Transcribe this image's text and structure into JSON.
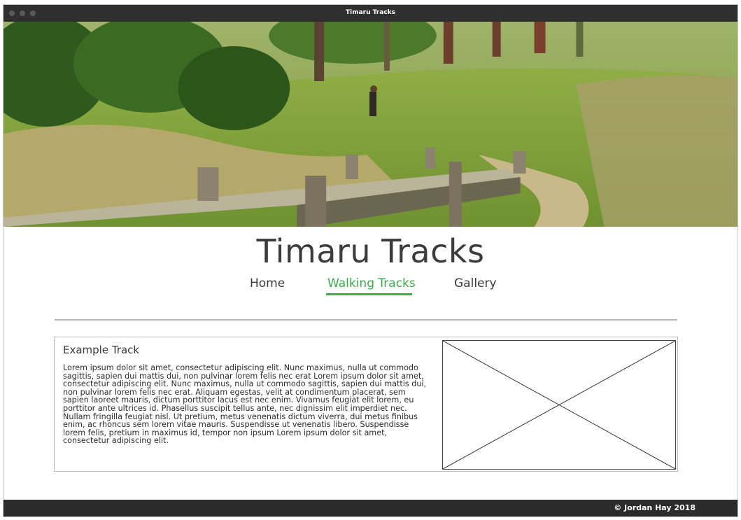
{
  "window": {
    "title": "Timaru Tracks"
  },
  "site": {
    "title": "Timaru Tracks"
  },
  "nav": {
    "items": [
      {
        "label": "Home",
        "active": false
      },
      {
        "label": "Walking Tracks",
        "active": true
      },
      {
        "label": "Gallery",
        "active": false
      }
    ]
  },
  "content": {
    "card_title": "Example Track",
    "card_body": "Lorem ipsum dolor sit amet, consectetur adipiscing elit. Nunc maximus, nulla ut commodo sagittis, sapien dui mattis dui, non pulvinar lorem felis nec erat Lorem ipsum dolor sit amet, consectetur adipiscing elit. Nunc maximus, nulla ut commodo sagittis, sapien dui mattis dui, non pulvinar lorem felis nec erat. Aliquam egestas, velit at condimentum placerat, sem sapien laoreet mauris, dictum porttitor lacus est nec enim. Vivamus feugiat elit lorem, eu porttitor ante ultrices id. Phasellus suscipit tellus ante, nec dignissim elit imperdiet nec. Nullam fringilla feugiat nisl. Ut pretium, metus venenatis dictum viverra, dui metus finibus enim, ac rhoncus sem lorem vitae mauris. Suspendisse ut venenatis libero. Suspendisse lorem felis, pretium in maximus id, tempor non ipsum Lorem ipsum dolor sit amet, consectetur adipiscing elit."
  },
  "footer": {
    "text": "© Jordan Hay 2018"
  },
  "colors": {
    "accent": "#3aaa4a",
    "titlebar": "#2f2f2f",
    "footer": "#2b2b2b"
  },
  "icons": {
    "hero": "hero-landscape-image",
    "placeholder": "image-placeholder-icon"
  }
}
